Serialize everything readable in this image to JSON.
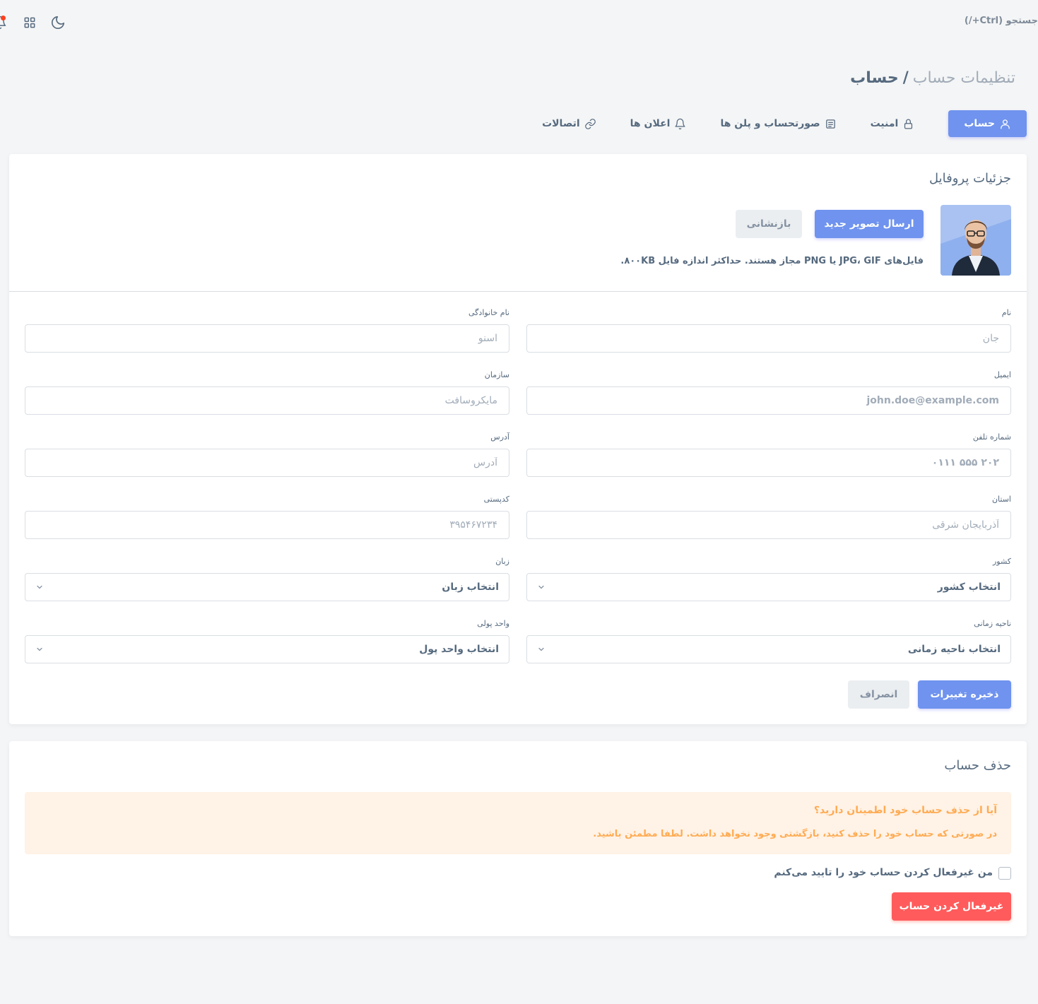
{
  "topbar": {
    "search_hint": "جستجو (Ctrl+/)",
    "icons": [
      "notification-bell-icon",
      "apps-grid-icon",
      "moon-icon"
    ]
  },
  "breadcrumb": {
    "parent": "تنظیمات حساب",
    "separator": "/",
    "current": "حساب"
  },
  "tabs": [
    {
      "label": "حساب",
      "icon": "user-icon",
      "active": true
    },
    {
      "label": "امنیت",
      "icon": "lock-icon",
      "active": false
    },
    {
      "label": "صورتحساب و پلن ها",
      "icon": "receipt-icon",
      "active": false
    },
    {
      "label": "اعلان ها",
      "icon": "bell-icon",
      "active": false
    },
    {
      "label": "اتصالات",
      "icon": "link-icon",
      "active": false
    }
  ],
  "profile": {
    "title": "جزئیات پروفایل",
    "upload_button": "ارسال تصویر جدید",
    "reset_button": "بازنشانی",
    "upload_hint": "فایل‌های JPG، GIF یا PNG مجاز هستند. حداکثر اندازه فایل ۸۰۰KB."
  },
  "form": {
    "first_name": {
      "label": "نام",
      "value": "جان"
    },
    "last_name": {
      "label": "نام خانوادگی",
      "value": "اسنو"
    },
    "email": {
      "label": "ایمیل",
      "value": "john.doe@example.com"
    },
    "organization": {
      "label": "سازمان",
      "value": "مایکروسافت"
    },
    "phone": {
      "label": "شماره تلفن",
      "value": "۲۰۲ ۵۵۵ ۰۱۱۱"
    },
    "address": {
      "label": "آدرس",
      "placeholder": "آدرس"
    },
    "state": {
      "label": "استان",
      "placeholder": "آذربایجان شرقی"
    },
    "zip": {
      "label": "کدپستی",
      "placeholder": "۳۹۵۴۶۷۲۳۴"
    },
    "country": {
      "label": "کشور",
      "selected": "انتخاب کشور"
    },
    "language": {
      "label": "زبان",
      "selected": "انتخاب زبان"
    },
    "timezone": {
      "label": "ناحیه زمانی",
      "selected": "انتخاب ناحیه زمانی"
    },
    "currency": {
      "label": "واحد پولی",
      "selected": "انتخاب واحد پول"
    },
    "save_button": "ذخیره تغییرات",
    "cancel_button": "انصراف"
  },
  "delete_account": {
    "title": "حذف حساب",
    "alert_heading": "آیا از حذف حساب خود اطمینان دارید؟",
    "alert_body": "در صورتی که حساب خود را حذف کنید، بازگشتی وجود نخواهد داشت. لطفا مطمئن باشید.",
    "checkbox_label": "من غیرفعال کردن حساب خود را تایید می‌کنم",
    "checkbox_checked": false,
    "deactivate_button": "غیرفعال کردن حساب"
  },
  "colors": {
    "primary": "#6f93ee",
    "danger": "#ff5b5c",
    "warning_text": "#ffab52",
    "warning_bg": "#fff2e6",
    "page_bg": "#f4f5f6"
  }
}
